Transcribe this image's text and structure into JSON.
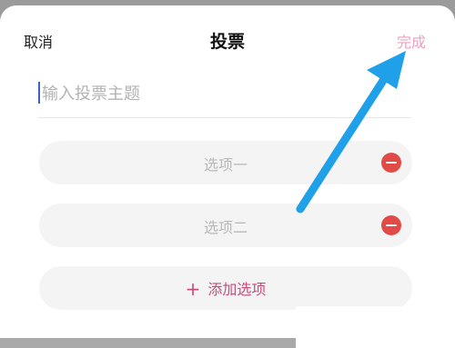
{
  "nav": {
    "cancel_label": "取消",
    "title": "投票",
    "done_label": "完成"
  },
  "topic": {
    "placeholder": "输入投票主题",
    "value": ""
  },
  "options": [
    {
      "label": "选项一"
    },
    {
      "label": "选项二"
    }
  ],
  "add_option_label": "添加选项",
  "icons": {
    "add": "plus-icon",
    "remove": "minus-circle-icon",
    "annotation": "arrow-icon"
  },
  "colors": {
    "accent": "#c94b7e",
    "done": "#e9a2be",
    "remove": "#e14b47",
    "arrow": "#1fa0e8"
  }
}
